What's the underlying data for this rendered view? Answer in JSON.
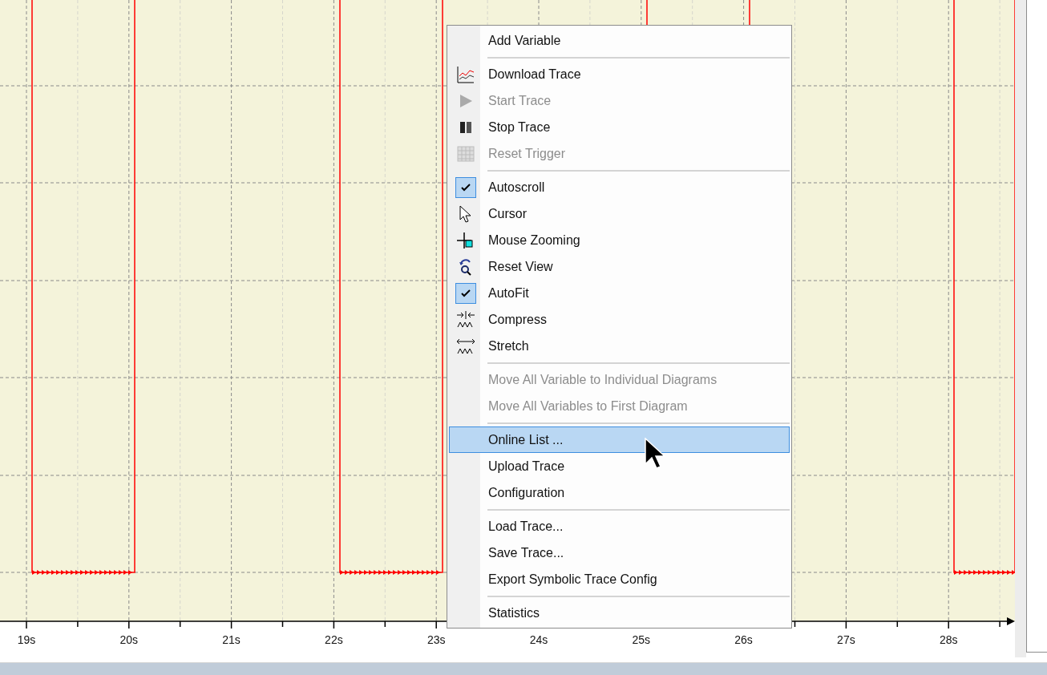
{
  "time_axis": {
    "labels": [
      "19s",
      "20s",
      "21s",
      "22s",
      "23s",
      "24s",
      "25s",
      "26s",
      "27s",
      "28s"
    ]
  },
  "context_menu": {
    "items": [
      {
        "kind": "item",
        "label": "Add Variable",
        "disabled": false,
        "checked": false,
        "selected": false
      },
      {
        "kind": "separator"
      },
      {
        "kind": "item",
        "label": "Download Trace",
        "disabled": false,
        "checked": false,
        "selected": false
      },
      {
        "kind": "item",
        "label": "Start Trace",
        "disabled": true,
        "checked": false,
        "selected": false
      },
      {
        "kind": "item",
        "label": "Stop Trace",
        "disabled": false,
        "checked": false,
        "selected": false
      },
      {
        "kind": "item",
        "label": "Reset Trigger",
        "disabled": true,
        "checked": false,
        "selected": false
      },
      {
        "kind": "separator"
      },
      {
        "kind": "item",
        "label": "Autoscroll",
        "disabled": false,
        "checked": true,
        "selected": false
      },
      {
        "kind": "item",
        "label": "Cursor",
        "disabled": false,
        "checked": false,
        "selected": false
      },
      {
        "kind": "item",
        "label": "Mouse Zooming",
        "disabled": false,
        "checked": false,
        "selected": false
      },
      {
        "kind": "item",
        "label": "Reset View",
        "disabled": false,
        "checked": false,
        "selected": false
      },
      {
        "kind": "item",
        "label": "AutoFit",
        "disabled": false,
        "checked": true,
        "selected": false
      },
      {
        "kind": "item",
        "label": "Compress",
        "disabled": false,
        "checked": false,
        "selected": false
      },
      {
        "kind": "item",
        "label": "Stretch",
        "disabled": false,
        "checked": false,
        "selected": false
      },
      {
        "kind": "separator"
      },
      {
        "kind": "item",
        "label": "Move All Variable to Individual Diagrams",
        "disabled": true,
        "checked": false,
        "selected": false
      },
      {
        "kind": "item",
        "label": "Move All Variables to First Diagram",
        "disabled": true,
        "checked": false,
        "selected": false
      },
      {
        "kind": "separator"
      },
      {
        "kind": "item",
        "label": "Online List ...",
        "disabled": false,
        "checked": false,
        "selected": true
      },
      {
        "kind": "item",
        "label": "Upload Trace",
        "disabled": false,
        "checked": false,
        "selected": false
      },
      {
        "kind": "item",
        "label": "Configuration",
        "disabled": false,
        "checked": false,
        "selected": false
      },
      {
        "kind": "separator"
      },
      {
        "kind": "item",
        "label": "Load Trace...",
        "disabled": false,
        "checked": false,
        "selected": false
      },
      {
        "kind": "item",
        "label": "Save Trace...",
        "disabled": false,
        "checked": false,
        "selected": false
      },
      {
        "kind": "item",
        "label": "Export Symbolic Trace Config",
        "disabled": false,
        "checked": false,
        "selected": false
      },
      {
        "kind": "separator"
      },
      {
        "kind": "item",
        "label": "Statistics",
        "disabled": false,
        "checked": false,
        "selected": false
      }
    ]
  }
}
